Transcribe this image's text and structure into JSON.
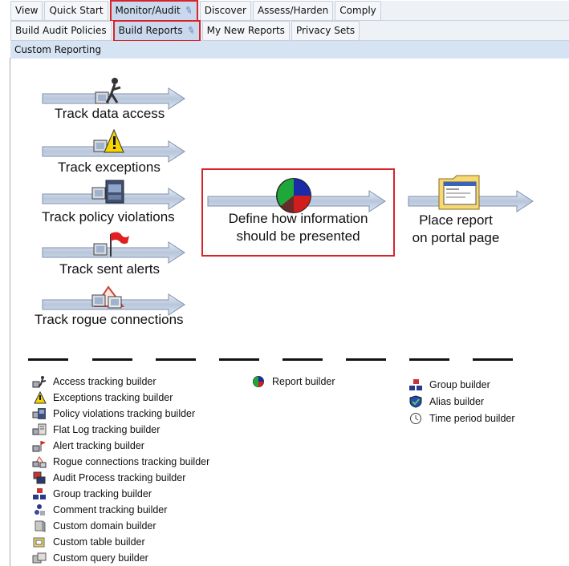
{
  "tabs_row1": [
    "View",
    "Quick Start",
    "Monitor/Audit",
    "Discover",
    "Assess/Harden",
    "Comply"
  ],
  "tabs_row2": [
    "Build Audit Policies",
    "Build Reports",
    "My New Reports",
    "Privacy Sets"
  ],
  "highlighted": [
    "Monitor/Audit",
    "Build Reports"
  ],
  "subheader": "Custom Reporting",
  "steps": {
    "track": [
      "Track data access",
      "Track exceptions",
      "Track policy violations",
      "Track sent alerts",
      "Track rogue connections"
    ],
    "define": [
      "Define how information",
      "should be presented"
    ],
    "place": [
      "Place report",
      "on portal page"
    ]
  },
  "legend_col1": [
    {
      "label": "Access tracking builder",
      "icon": "access-tracking-icon"
    },
    {
      "label": "Exceptions tracking builder",
      "icon": "exceptions-warning-icon"
    },
    {
      "label": "Policy violations tracking builder",
      "icon": "policy-violations-icon"
    },
    {
      "label": "Flat Log tracking builder",
      "icon": "flat-log-icon"
    },
    {
      "label": "Alert tracking builder",
      "icon": "alert-flag-icon"
    },
    {
      "label": "Rogue connections tracking builder",
      "icon": "rogue-connections-icon"
    },
    {
      "label": "Audit Process tracking builder",
      "icon": "audit-process-icon"
    },
    {
      "label": "Group tracking builder",
      "icon": "group-tracking-icon"
    },
    {
      "label": "Comment tracking builder",
      "icon": "comment-tracking-icon"
    },
    {
      "label": "Custom domain builder",
      "icon": "custom-domain-icon"
    },
    {
      "label": "Custom table builder",
      "icon": "custom-table-icon"
    },
    {
      "label": "Custom query builder",
      "icon": "custom-query-icon"
    }
  ],
  "legend_col2": [
    {
      "label": "Report builder",
      "icon": "pie-chart-icon"
    }
  ],
  "legend_col3": [
    {
      "label": "Group builder",
      "icon": "group-builder-icon"
    },
    {
      "label": "Alias builder",
      "icon": "alias-shield-icon"
    },
    {
      "label": "Time period builder",
      "icon": "clock-icon"
    }
  ]
}
